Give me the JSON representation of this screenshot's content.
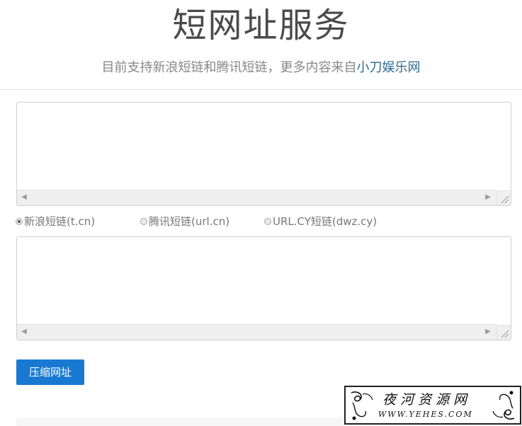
{
  "header": {
    "title": "短网址服务",
    "subtitle_prefix": "目前支持新浪短链和腾讯短链，更多内容来自",
    "subtitle_link": "小刀娱乐网"
  },
  "input_box": {
    "value": ""
  },
  "options": [
    {
      "label": "新浪短链(t.cn)",
      "checked": true
    },
    {
      "label": "腾讯短链(url.cn)",
      "checked": false
    },
    {
      "label": "URL.CY短链(dwz.cy)",
      "checked": false
    }
  ],
  "output_box": {
    "value": ""
  },
  "actions": {
    "submit_label": "压缩网址"
  },
  "watermark": {
    "title": "夜河资源网",
    "url": "WWW.YEHES.COM"
  },
  "colors": {
    "button": "#1979d2",
    "link": "#2d6b8f"
  }
}
